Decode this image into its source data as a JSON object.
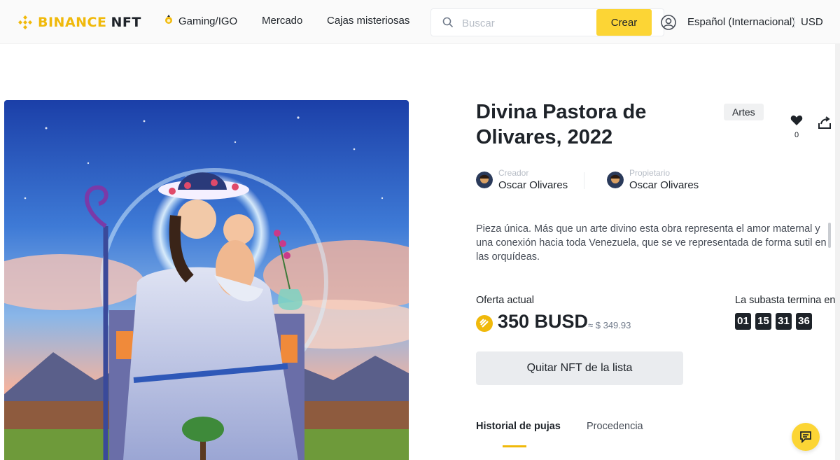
{
  "header": {
    "logo_brand": "BINANCE",
    "logo_suffix": "NFT",
    "nav": {
      "gaming": "Gaming/IGO",
      "mercado": "Mercado",
      "cajas": "Cajas misteriosas"
    },
    "search_placeholder": "Buscar",
    "crear_label": "Crear",
    "language": "Español (Internacional)",
    "currency": "USD"
  },
  "nft": {
    "title": "Divina Pastora de Olivares, 2022",
    "category": "Artes",
    "likes": "0",
    "creator_label": "Creador",
    "creator_name": "Oscar Olivares",
    "owner_label": "Propietario",
    "owner_name": "Oscar Olivares",
    "description": "Pieza única. Más que un arte divino esta obra representa el amor maternal y una conexión hacia toda Venezuela, que se ve representada de forma sutil en las orquídeas."
  },
  "offer": {
    "label": "Oferta actual",
    "amount": "350 BUSD",
    "usd_equiv": "≈ $ 349.93"
  },
  "auction": {
    "label": "La subasta termina en",
    "timer": [
      "01",
      "15",
      "31",
      "36"
    ]
  },
  "actions": {
    "delist_label": "Quitar NFT de la lista"
  },
  "tabs": {
    "history": "Historial de pujas",
    "provenance": "Procedencia"
  },
  "colors": {
    "brand_yellow": "#F0B90B",
    "button_yellow": "#FCD535",
    "text_dark": "#1E2329"
  }
}
